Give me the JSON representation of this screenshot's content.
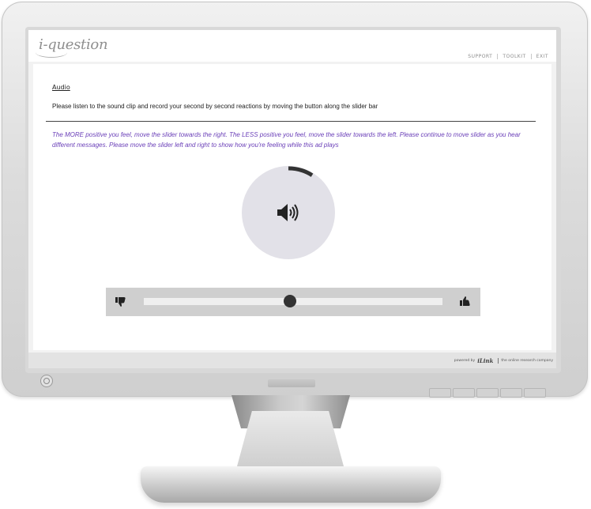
{
  "app": {
    "logo_text": "i-question"
  },
  "topnav": {
    "items": [
      {
        "label": "SUPPORT"
      },
      {
        "label": "TOOLKIT"
      },
      {
        "label": "EXIT"
      }
    ]
  },
  "survey": {
    "section_title": "Audio",
    "question": "Please listen to the sound clip and record your second by second reactions by moving the button along the slider bar",
    "instructions": "The MORE positive you feel, move the slider towards the right. The LESS positive you feel, move the slider towards the left. Please continue to move slider as you hear different messages. Please move the slider left and right to show how you're feeling while this ad plays"
  },
  "audio_player": {
    "icon": "speaker-icon",
    "progress_fraction": 0.09
  },
  "slider": {
    "min_icon": "thumbs-down-icon",
    "max_icon": "thumbs-up-icon",
    "value_fraction": 0.49
  },
  "footer": {
    "powered_by": "powered by",
    "brand": "iLink",
    "tagline": "the online research company"
  },
  "colors": {
    "instructions": "#6a3fb8",
    "player_bg": "#e2e1e8",
    "slider_panel": "#cfcfcf"
  }
}
